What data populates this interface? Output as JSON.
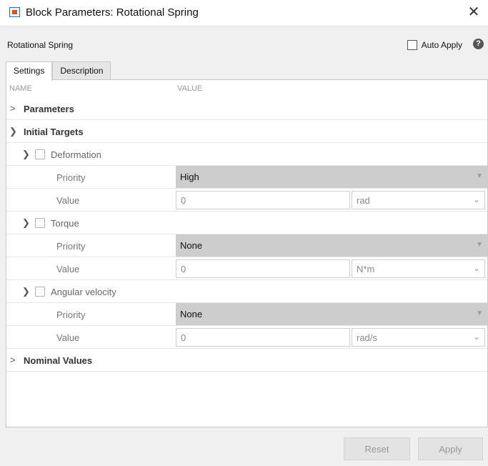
{
  "window": {
    "title": "Block Parameters: Rotational Spring",
    "close_glyph": "✕",
    "icon": "simulink-block-icon"
  },
  "header": {
    "block_name": "Rotational Spring",
    "auto_apply_label": "Auto Apply",
    "auto_apply_checked": false,
    "help_glyph": "?"
  },
  "tabs": [
    {
      "label": "Settings",
      "active": true
    },
    {
      "label": "Description",
      "active": false
    }
  ],
  "table": {
    "col_name": "NAME",
    "col_value": "VALUE",
    "sections": {
      "parameters": "Parameters",
      "initial_targets": "Initial Targets",
      "nominal_values": "Nominal Values"
    },
    "groups": [
      {
        "name": "Deformation",
        "checked": false,
        "priority_label": "Priority",
        "priority": "High",
        "value_label": "Value",
        "value": "0",
        "unit": "rad"
      },
      {
        "name": "Torque",
        "checked": false,
        "priority_label": "Priority",
        "priority": "None",
        "value_label": "Value",
        "value": "0",
        "unit": "N*m"
      },
      {
        "name": "Angular velocity",
        "checked": false,
        "priority_label": "Priority",
        "priority": "None",
        "value_label": "Value",
        "value": "0",
        "unit": "rad/s"
      }
    ]
  },
  "footer": {
    "reset_label": "Reset",
    "apply_label": "Apply"
  }
}
